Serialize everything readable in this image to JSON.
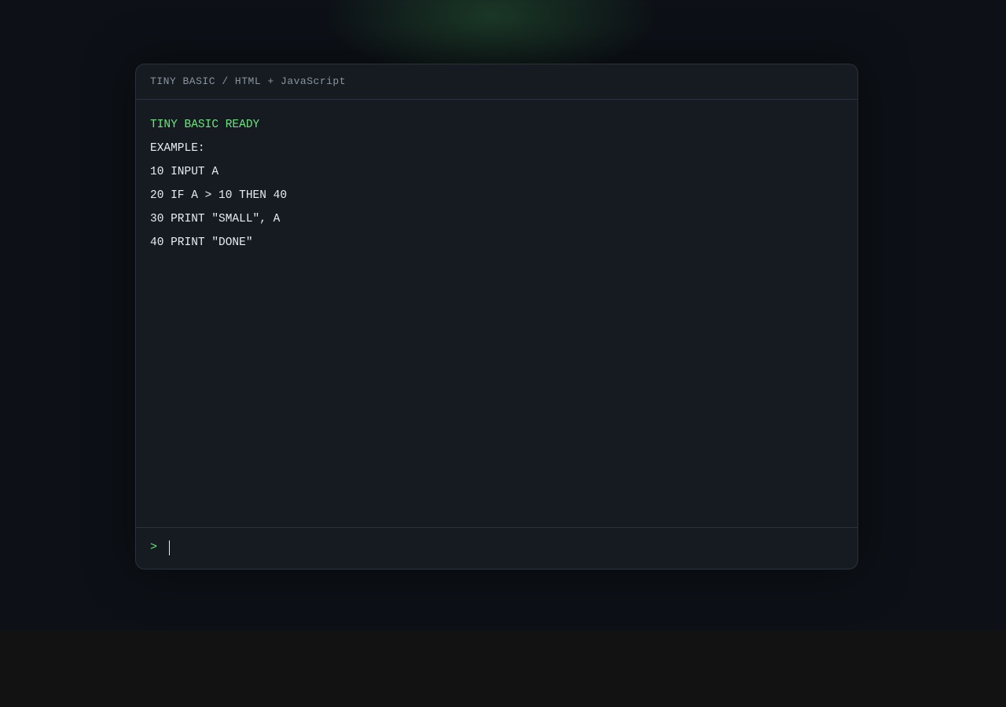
{
  "window": {
    "title": "TINY BASIC / HTML + JavaScript"
  },
  "output": {
    "lines": [
      "TINY BASIC READY",
      "EXAMPLE:",
      "10 INPUT A",
      "20 IF A > 10 THEN 40",
      "30 PRINT \"SMALL\", A",
      "40 PRINT \"DONE\""
    ]
  },
  "input": {
    "prompt": ">",
    "value": ""
  },
  "colors": {
    "accent_green": "#6ee37f",
    "panel_background": "#161b22",
    "page_background": "#0d1117",
    "text": "#e6edf3",
    "muted_text": "#8b949e"
  }
}
